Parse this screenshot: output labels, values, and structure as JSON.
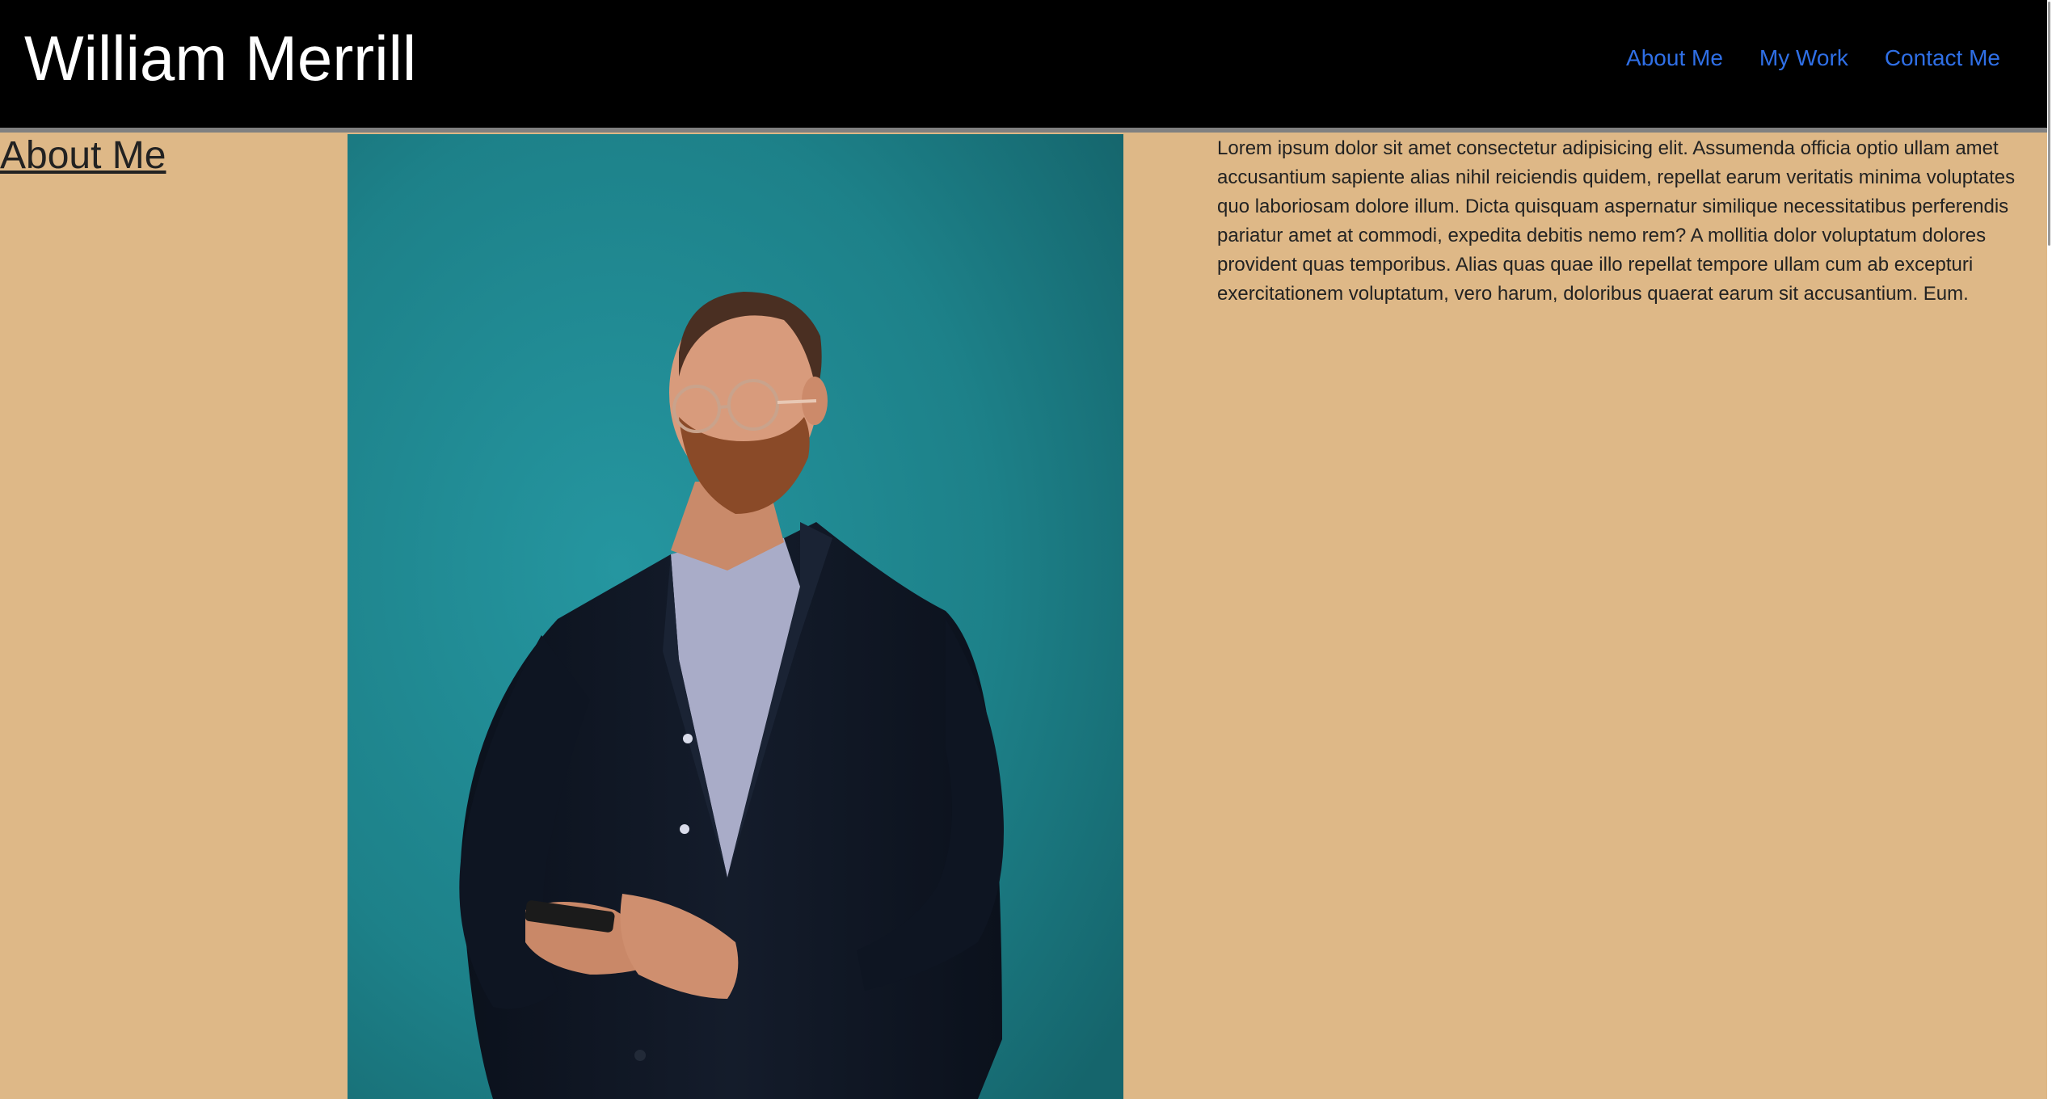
{
  "header": {
    "site_title": "William Merrill",
    "nav": [
      {
        "label": "About Me"
      },
      {
        "label": "My Work"
      },
      {
        "label": "Contact Me"
      }
    ]
  },
  "main": {
    "heading": "About Me",
    "bio": "Lorem ipsum dolor sit amet consectetur adipisicing elit. Assumenda officia optio ullam amet accusantium sapiente alias nihil reiciendis quidem, repellat earum veritatis minima voluptates quo laboriosam dolore illum. Dicta quisquam aspernatur similique necessitatibus perferendis pariatur amet at commodi, expedita debitis nemo rem? A mollitia dolor voluptatum dolores provident quas temporibus. Alias quas quae illo repellat tempore ullam cum ab excepturi exercitationem voluptatum, vero harum, doloribus quaerat earum sit accusantium. Eum."
  },
  "colors": {
    "header_bg": "#000000",
    "page_bg": "#DEB887",
    "nav_link": "#2f6fe6",
    "photo_bg": "#1f8a92"
  }
}
